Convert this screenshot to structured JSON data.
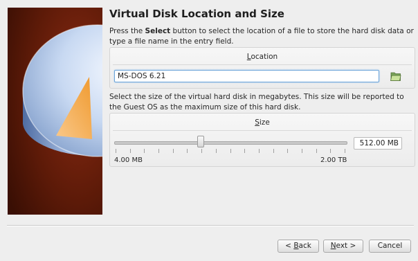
{
  "wizard": {
    "title": "Virtual Disk Location and Size",
    "intro_prefix": "Press the ",
    "intro_bold": "Select",
    "intro_suffix": " button to select the location of a file to store the hard disk data or type a file name in the entry field.",
    "size_description": "Select the size of the virtual hard disk in megabytes. This size will be reported to the Guest OS as the maximum size of this hard disk."
  },
  "location": {
    "header_prefix": "",
    "header_accel": "L",
    "header_suffix": "ocation",
    "value": "MS-DOS 6.21",
    "select_icon": "folder-open-icon"
  },
  "size": {
    "header_prefix": "",
    "header_accel": "S",
    "header_suffix": "ize",
    "value": "512.00 MB",
    "min_label": "4.00 MB",
    "max_label": "2.00 TB",
    "slider_fraction": 0.37,
    "tick_count": 17
  },
  "buttons": {
    "back_prefix": "< ",
    "back_accel": "B",
    "back_suffix": "ack",
    "next_prefix": "",
    "next_accel": "N",
    "next_suffix": "ext >",
    "cancel_label": "Cancel"
  },
  "side_image": "hard-disk-illustration",
  "colors": {
    "accent_focus": "#6aa3d8",
    "side_background": "#5a1a0a",
    "disk_wedge": "#f4a340"
  }
}
